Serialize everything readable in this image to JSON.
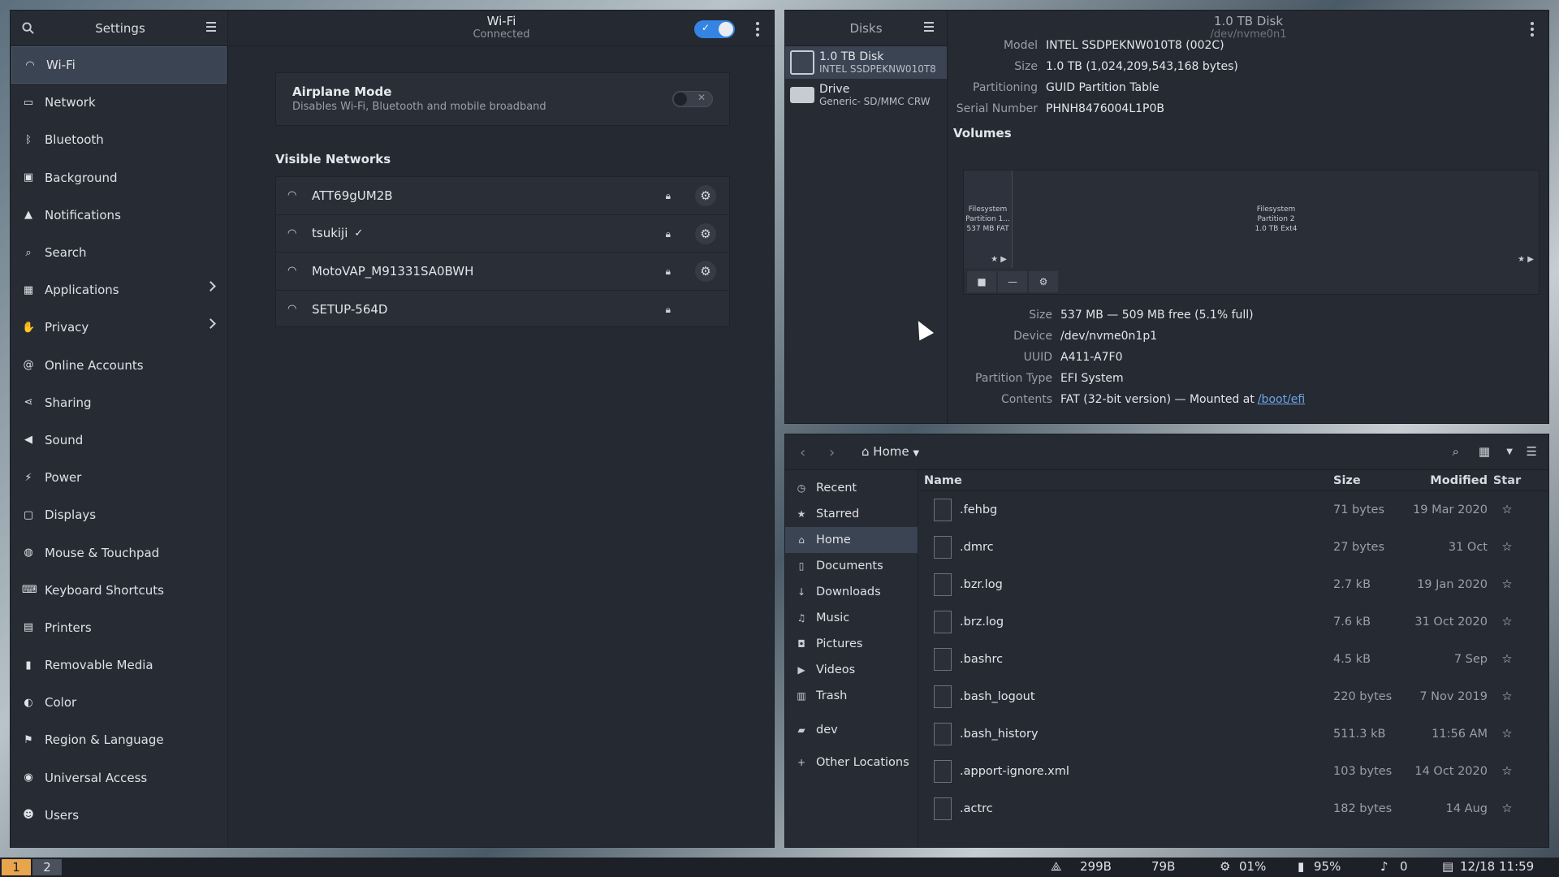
{
  "settings": {
    "sidebar_title": "Settings",
    "items": [
      {
        "label": "Wi-Fi",
        "icon": "wifi-icon"
      },
      {
        "label": "Network",
        "icon": "network-icon"
      },
      {
        "label": "Bluetooth",
        "icon": "bluetooth-icon"
      },
      {
        "label": "Background",
        "icon": "background-icon"
      },
      {
        "label": "Notifications",
        "icon": "bell-icon"
      },
      {
        "label": "Search",
        "icon": "search-icon"
      },
      {
        "label": "Applications",
        "icon": "apps-icon"
      },
      {
        "label": "Privacy",
        "icon": "hand-icon"
      },
      {
        "label": "Online Accounts",
        "icon": "at-icon"
      },
      {
        "label": "Sharing",
        "icon": "share-icon"
      },
      {
        "label": "Sound",
        "icon": "speaker-icon"
      },
      {
        "label": "Power",
        "icon": "power-icon"
      },
      {
        "label": "Displays",
        "icon": "display-icon"
      },
      {
        "label": "Mouse & Touchpad",
        "icon": "mouse-icon"
      },
      {
        "label": "Keyboard Shortcuts",
        "icon": "keyboard-icon"
      },
      {
        "label": "Printers",
        "icon": "printer-icon"
      },
      {
        "label": "Removable Media",
        "icon": "usb-icon"
      },
      {
        "label": "Color",
        "icon": "color-icon"
      },
      {
        "label": "Region & Language",
        "icon": "flag-icon"
      },
      {
        "label": "Universal Access",
        "icon": "accessibility-icon"
      },
      {
        "label": "Users",
        "icon": "users-icon"
      }
    ],
    "header_title": "Wi-Fi",
    "header_subtitle": "Connected",
    "airplane_title": "Airplane Mode",
    "airplane_subtitle": "Disables Wi-Fi, Bluetooth and mobile broadband",
    "visible_networks": "Visible Networks",
    "networks": [
      {
        "name": "ATT69gUM2B",
        "connected": false,
        "gear": true
      },
      {
        "name": "tsukiji",
        "connected": true,
        "gear": true
      },
      {
        "name": "MotoVAP_M91331SA0BWH",
        "connected": false,
        "gear": true
      },
      {
        "name": "SETUP-564D",
        "connected": false,
        "gear": false
      }
    ]
  },
  "disks": {
    "sidebar_title": "Disks",
    "devices": [
      {
        "name": "1.0 TB Disk",
        "sub": "INTEL SSDPEKNW010T8"
      },
      {
        "name": "Drive",
        "sub": "Generic- SD/MMC CRW"
      }
    ],
    "title": "1.0 TB Disk",
    "subtitle": "/dev/nvme0n1",
    "info": [
      {
        "k": "Model",
        "v": "INTEL SSDPEKNW010T8 (002C)"
      },
      {
        "k": "Size",
        "v": "1.0 TB (1,024,209,543,168 bytes)"
      },
      {
        "k": "Partitioning",
        "v": "GUID Partition Table"
      },
      {
        "k": "Serial Number",
        "v": "PHNH8476004L1P0B"
      }
    ],
    "volumes_title": "Volumes",
    "p1": {
      "l1": "Filesystem",
      "l2": "Partition 1...",
      "l3": "537 MB FAT"
    },
    "p2": {
      "l1": "Filesystem",
      "l2": "Partition 2",
      "l3": "1.0 TB Ext4"
    },
    "part_info": [
      {
        "k": "Size",
        "v": "537 MB — 509 MB free (5.1% full)"
      },
      {
        "k": "Device",
        "v": "/dev/nvme0n1p1"
      },
      {
        "k": "UUID",
        "v": "A411-A7F0"
      },
      {
        "k": "Partition Type",
        "v": "EFI System"
      },
      {
        "k": "Contents",
        "v": "FAT (32-bit version) — Mounted at "
      }
    ],
    "mount_link": "/boot/efi"
  },
  "files": {
    "location": "Home",
    "places": [
      {
        "label": "Recent",
        "icon": "clock-icon"
      },
      {
        "label": "Starred",
        "icon": "star-icon"
      },
      {
        "label": "Home",
        "icon": "home-icon"
      },
      {
        "label": "Documents",
        "icon": "document-icon"
      },
      {
        "label": "Downloads",
        "icon": "download-icon"
      },
      {
        "label": "Music",
        "icon": "music-icon"
      },
      {
        "label": "Pictures",
        "icon": "camera-icon"
      },
      {
        "label": "Videos",
        "icon": "video-icon"
      },
      {
        "label": "Trash",
        "icon": "trash-icon"
      },
      {
        "label": "dev",
        "icon": "folder-icon"
      },
      {
        "label": "Other Locations",
        "icon": "plus-icon"
      }
    ],
    "columns": {
      "name": "Name",
      "size": "Size",
      "modified": "Modified",
      "star": "Star"
    },
    "rows": [
      {
        "name": ".fehbg",
        "size": "71 bytes",
        "modified": "19 Mar 2020"
      },
      {
        "name": ".dmrc",
        "size": "27 bytes",
        "modified": "31 Oct"
      },
      {
        "name": ".bzr.log",
        "size": "2.7 kB",
        "modified": "19 Jan 2020"
      },
      {
        "name": ".brz.log",
        "size": "7.6 kB",
        "modified": "31 Oct 2020"
      },
      {
        "name": ".bashrc",
        "size": "4.5 kB",
        "modified": "7 Sep"
      },
      {
        "name": ".bash_logout",
        "size": "220 bytes",
        "modified": "7 Nov 2019"
      },
      {
        "name": ".bash_history",
        "size": "511.3 kB",
        "modified": "11:56 AM"
      },
      {
        "name": ".apport-ignore.xml",
        "size": "103 bytes",
        "modified": "14 Oct 2020"
      },
      {
        "name": ".actrc",
        "size": "182 bytes",
        "modified": "14 Aug"
      }
    ]
  },
  "bar": {
    "ws1": "1",
    "ws2": "2",
    "net_down": "299B",
    "net_up": "79B",
    "cpu": "01%",
    "battery": "95%",
    "notifications": "0",
    "datetime": "12/18 11:59"
  },
  "colors": {
    "accent": "#3584e4",
    "workspace_active": "#e8a54b"
  }
}
